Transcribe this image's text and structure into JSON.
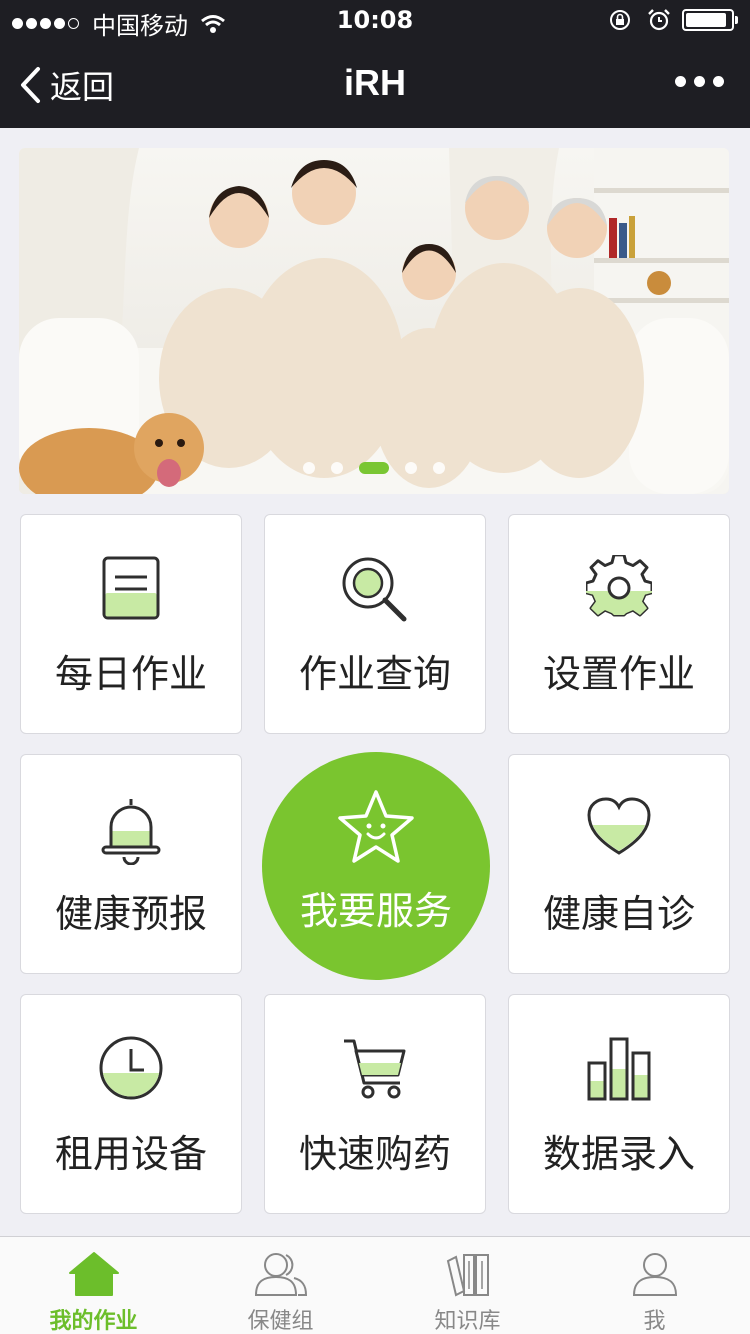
{
  "status_bar": {
    "carrier": "中国移动",
    "time": "10:08"
  },
  "nav": {
    "back_label": "返回",
    "title": "iRH"
  },
  "banner": {
    "pages": 5,
    "active_page": 3
  },
  "grid": [
    {
      "label": "每日作业",
      "icon": "task-list-icon"
    },
    {
      "label": "作业查询",
      "icon": "search-icon"
    },
    {
      "label": "设置作业",
      "icon": "gear-icon"
    },
    {
      "label": "健康预报",
      "icon": "bell-icon"
    },
    {
      "label": "我要服务",
      "icon": "star-smile-icon"
    },
    {
      "label": "健康自诊",
      "icon": "heart-icon"
    },
    {
      "label": "租用设备",
      "icon": "clock-icon"
    },
    {
      "label": "快速购药",
      "icon": "cart-icon"
    },
    {
      "label": "数据录入",
      "icon": "bar-chart-icon"
    }
  ],
  "tabbar": [
    {
      "label": "我的作业",
      "icon": "home-icon",
      "active": true
    },
    {
      "label": "保健组",
      "icon": "group-icon",
      "active": false
    },
    {
      "label": "知识库",
      "icon": "books-icon",
      "active": false
    },
    {
      "label": "我",
      "icon": "user-icon",
      "active": false
    }
  ],
  "colors": {
    "accent": "#7ac52f",
    "nav_bg": "#1e1e23",
    "page_bg": "#efeff4",
    "icon_fill": "#c8eaa4"
  }
}
